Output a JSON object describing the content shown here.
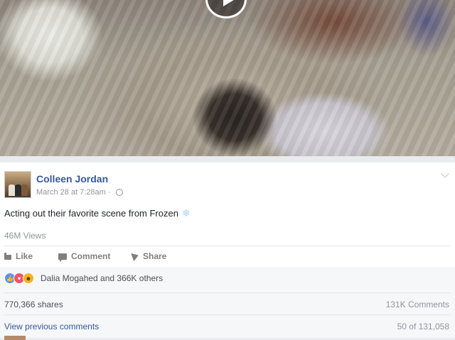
{
  "post": {
    "author": "Colleen Jordan",
    "timestamp": "March 28 at 7:28am",
    "separator": "·",
    "text": "Acting out their favorite scene from Frozen",
    "views": "46M Views"
  },
  "actions": {
    "like_label": "Like",
    "comment_label": "Comment",
    "share_label": "Share"
  },
  "reactions": {
    "icons": [
      "like-icon",
      "love-icon",
      "haha-icon"
    ],
    "names": "Dalia Mogahed and 366K others"
  },
  "stats": {
    "shares": "770,366 shares",
    "comments": "131K Comments"
  },
  "comments_nav": {
    "view_previous": "View previous comments",
    "count": "50 of 131,058"
  },
  "colors": {
    "link_blue": "#365899",
    "like_blue": "#5890ff",
    "love_red": "#f25268",
    "haha_yellow": "#f7b125"
  }
}
